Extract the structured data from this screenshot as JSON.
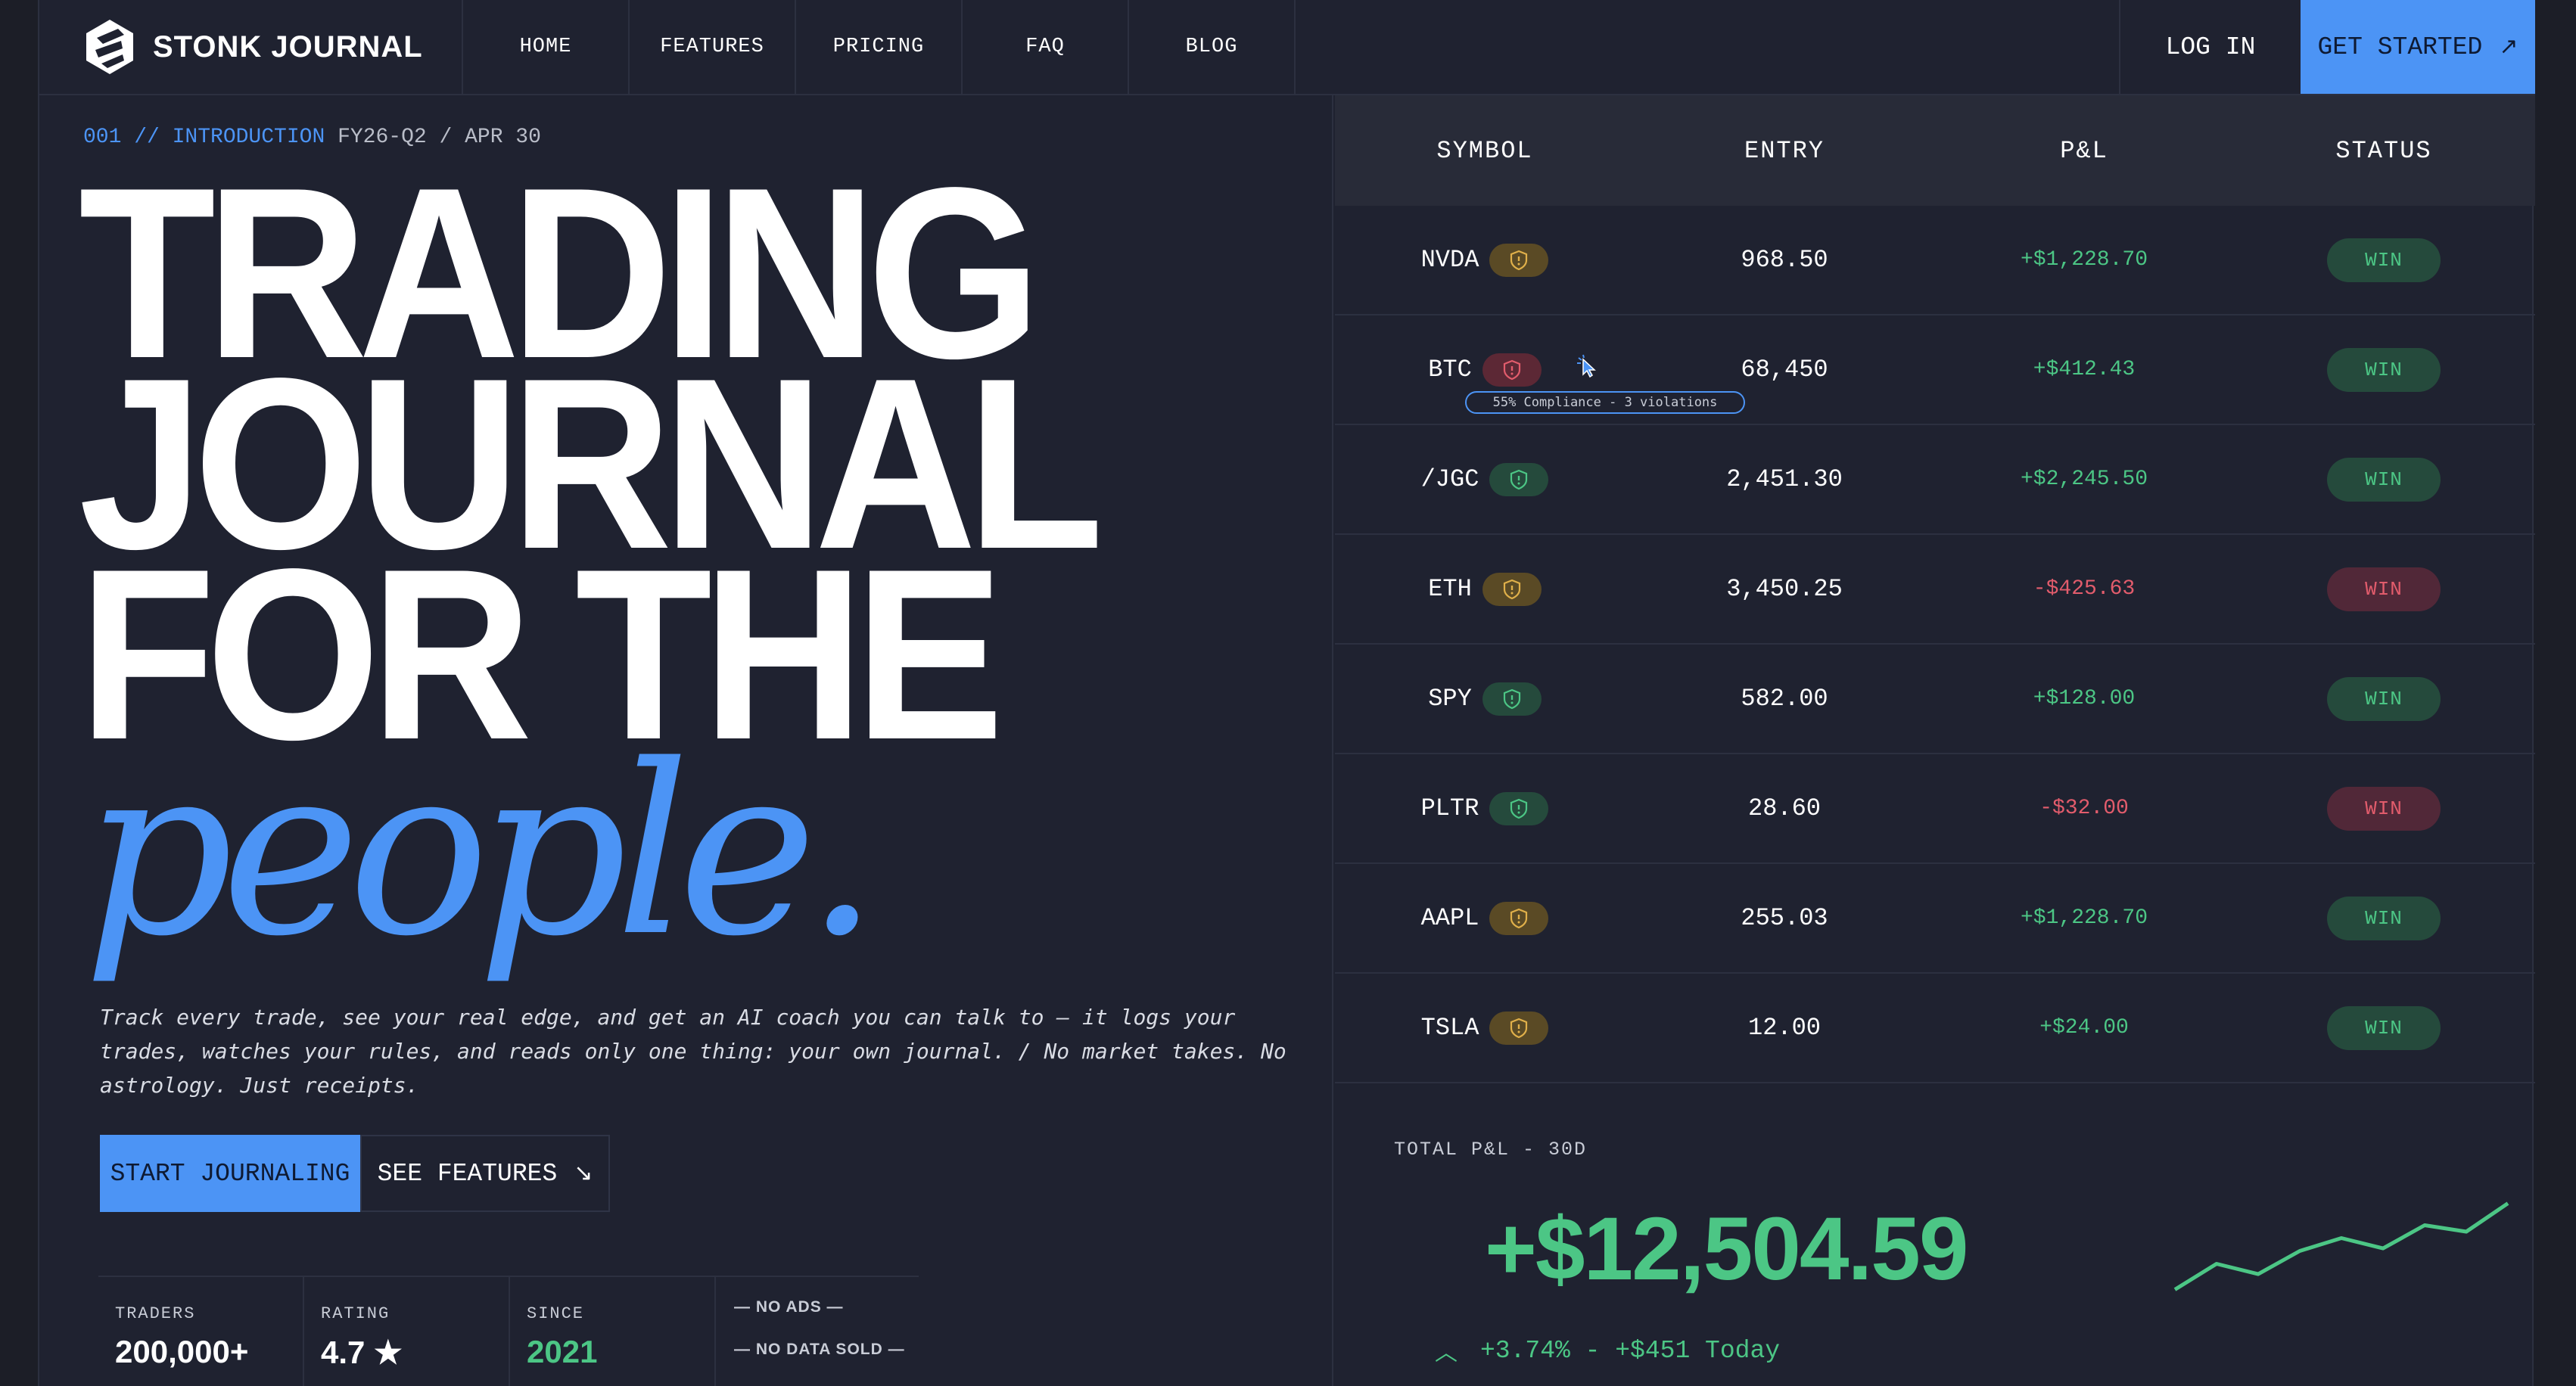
{
  "nav": {
    "brand": "STONK JOURNAL",
    "links": [
      "HOME",
      "FEATURES",
      "PRICING",
      "FAQ",
      "BLOG"
    ],
    "login": "LOG IN",
    "get_started": "GET STARTED"
  },
  "hero": {
    "crumb_highlight": "001 // INTRODUCTION",
    "crumb_rest": " FY26-Q2 / APR 30",
    "headline": [
      "TRADING",
      "JOURNAL",
      "FOR THE"
    ],
    "headline_accent": "people.",
    "lede": "Track every trade, see your real edge, and get an AI coach you can talk to — it logs your trades, watches your rules, and reads only one thing: your own journal. / No market takes. No astrology. Just receipts.",
    "cta_primary": "START JOURNALING",
    "cta_secondary": "SEE FEATURES",
    "stats": [
      {
        "label": "TRADERS",
        "value": "200,000+"
      },
      {
        "label": "RATING",
        "value": "4.7 ★"
      },
      {
        "label": "SINCE",
        "value": "2021"
      }
    ],
    "notes": [
      "— NO ADS —",
      "— NO DATA SOLD —"
    ]
  },
  "table": {
    "headers": [
      "SYMBOL",
      "ENTRY",
      "P&L",
      "STATUS"
    ],
    "rows": [
      {
        "symbol": "NVDA",
        "shield": "amber",
        "entry": "968.50",
        "pnl": "+$1,228.70",
        "pnl_sign": "pos",
        "status": "WIN",
        "status_kind": "win"
      },
      {
        "symbol": "BTC",
        "shield": "red",
        "entry": "68,450",
        "pnl": "+$412.43",
        "pnl_sign": "pos",
        "status": "WIN",
        "status_kind": "win"
      },
      {
        "symbol": "/JGC",
        "shield": "green",
        "entry": "2,451.30",
        "pnl": "+$2,245.50",
        "pnl_sign": "pos",
        "status": "WIN",
        "status_kind": "win"
      },
      {
        "symbol": "ETH",
        "shield": "amber",
        "entry": "3,450.25",
        "pnl": "-$425.63",
        "pnl_sign": "neg",
        "status": "WIN",
        "status_kind": "loss"
      },
      {
        "symbol": "SPY",
        "shield": "green",
        "entry": "582.00",
        "pnl": "+$128.00",
        "pnl_sign": "pos",
        "status": "WIN",
        "status_kind": "win"
      },
      {
        "symbol": "PLTR",
        "shield": "green",
        "entry": "28.60",
        "pnl": "-$32.00",
        "pnl_sign": "neg",
        "status": "WIN",
        "status_kind": "loss"
      },
      {
        "symbol": "AAPL",
        "shield": "amber",
        "entry": "255.03",
        "pnl": "+$1,228.70",
        "pnl_sign": "pos",
        "status": "WIN",
        "status_kind": "win"
      },
      {
        "symbol": "TSLA",
        "shield": "amber",
        "entry": "12.00",
        "pnl": "+$24.00",
        "pnl_sign": "pos",
        "status": "WIN",
        "status_kind": "win"
      }
    ],
    "tooltip": "55% Compliance - 3 violations"
  },
  "total": {
    "label": "TOTAL P&L - 30D",
    "value": "+$12,504.59",
    "change": "+3.74% - +$451 Today",
    "spark": [
      0.05,
      0.25,
      0.17,
      0.35,
      0.45,
      0.37,
      0.55,
      0.5,
      0.72
    ],
    "accent": "#4cc685"
  },
  "colors": {
    "brand": "#4c94f5",
    "bg": "#1f2230",
    "positive": "#4cc685",
    "negative": "#e25c6c"
  }
}
